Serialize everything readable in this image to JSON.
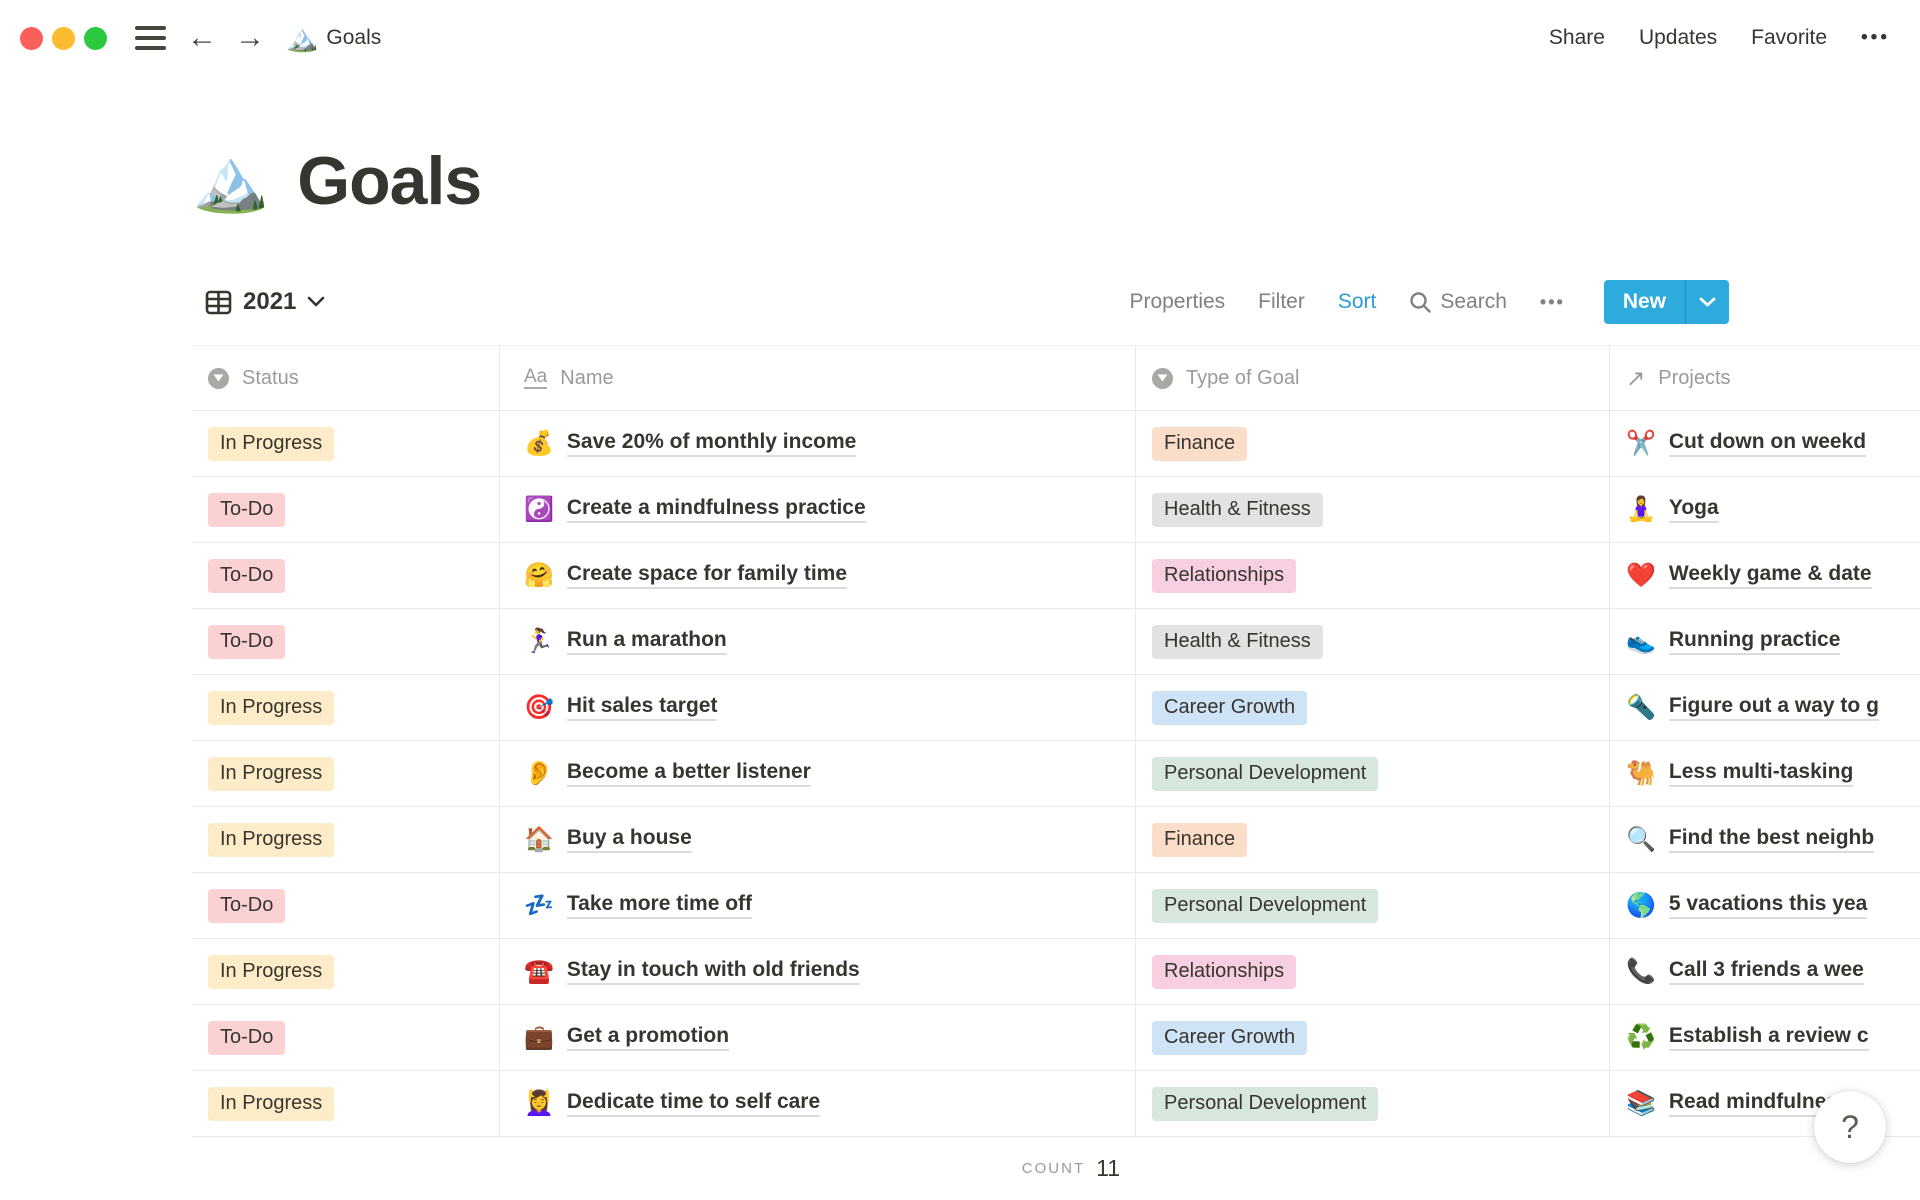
{
  "topbar": {
    "doc_icon": "🏔️",
    "doc_title": "Goals",
    "actions": [
      "Share",
      "Updates",
      "Favorite"
    ],
    "more": "•••"
  },
  "page": {
    "icon": "🏔️",
    "title": "Goals"
  },
  "toolbar": {
    "view_name": "2021",
    "properties": "Properties",
    "filter": "Filter",
    "sort": "Sort",
    "search": "Search",
    "more": "•••",
    "new_label": "New"
  },
  "columns": [
    {
      "key": "status",
      "label": "Status",
      "icon": "select-property-icon"
    },
    {
      "key": "name",
      "label": "Name",
      "icon": "title-property-icon"
    },
    {
      "key": "type",
      "label": "Type of Goal",
      "icon": "select-property-icon"
    },
    {
      "key": "projects",
      "label": "Projects",
      "icon": "relation-property-icon"
    }
  ],
  "rows": [
    {
      "status": "In Progress",
      "name_icon": "💰",
      "name": "Save 20% of monthly income",
      "type": "Finance",
      "project_icon": "✂️",
      "project": "Cut down on weekd"
    },
    {
      "status": "To-Do",
      "name_icon": "☯️",
      "name": "Create a mindfulness practice",
      "type": "Health & Fitness",
      "project_icon": "🧘‍♀️",
      "project": "Yoga"
    },
    {
      "status": "To-Do",
      "name_icon": "🤗",
      "name": "Create space for family time",
      "type": "Relationships",
      "project_icon": "❤️",
      "project": "Weekly game & date"
    },
    {
      "status": "To-Do",
      "name_icon": "🏃‍♀️",
      "name": "Run a marathon",
      "type": "Health & Fitness",
      "project_icon": "👟",
      "project": "Running practice"
    },
    {
      "status": "In Progress",
      "name_icon": "🎯",
      "name": "Hit sales target",
      "type": "Career Growth",
      "project_icon": "🔦",
      "project": "Figure out a way to g"
    },
    {
      "status": "In Progress",
      "name_icon": "👂",
      "name": "Become a better listener",
      "type": "Personal Development",
      "project_icon": "🐫",
      "project": "Less multi-tasking"
    },
    {
      "status": "In Progress",
      "name_icon": "🏠",
      "name": "Buy a house",
      "type": "Finance",
      "project_icon": "🔍",
      "project": "Find the best neighb"
    },
    {
      "status": "To-Do",
      "name_icon": "💤",
      "name": "Take more time off",
      "type": "Personal Development",
      "project_icon": "🌎",
      "project": "5 vacations this yea"
    },
    {
      "status": "In Progress",
      "name_icon": "☎️",
      "name": "Stay in touch with old friends",
      "type": "Relationships",
      "project_icon": "📞",
      "project": "Call 3 friends a wee"
    },
    {
      "status": "To-Do",
      "name_icon": "💼",
      "name": "Get a promotion",
      "type": "Career Growth",
      "project_icon": "♻️",
      "project": "Establish a review c"
    },
    {
      "status": "In Progress",
      "name_icon": "💆‍♀️",
      "name": "Dedicate time to self care",
      "type": "Personal Development",
      "project_icon": "📚",
      "project": "Read mindfulness b"
    }
  ],
  "footer": {
    "count_label": "COUNT",
    "count_value": "11"
  },
  "help_button": "?",
  "colors": {
    "accent_blue": "#2eaadc",
    "sort_blue": "#2b9dd6",
    "badges": {
      "In Progress": "#fdecc8",
      "To-Do": "#fbd2d4",
      "Finance": "#fadec9",
      "Health & Fitness": "#e3e2e0",
      "Relationships": "#f7cfe1",
      "Career Growth": "#cee3f6",
      "Personal Development": "#d7e7de"
    }
  }
}
